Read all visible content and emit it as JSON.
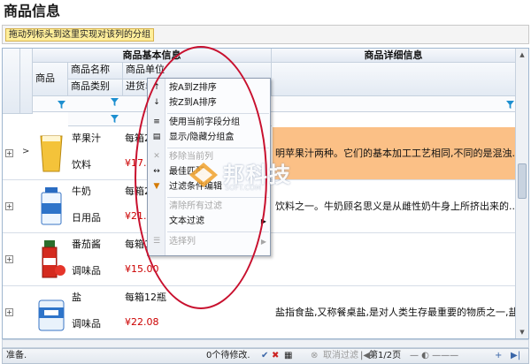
{
  "page": {
    "title": "商品信息"
  },
  "group_panel": {
    "hint": "拖动列标头到这里实现对该列的分组"
  },
  "grid": {
    "band_basic": "商品基本信息",
    "band_detail": "商品详细信息",
    "col_product": "商品",
    "col_name": "商品名称",
    "col_category": "商品类别",
    "col_unit": "商品单位",
    "col_price": "进货单价",
    "rows": [
      {
        "name": "苹果汁",
        "category": "饮料",
        "unit": "每箱24瓶",
        "price": "¥17.00",
        "detail": "明苹果汁两种。它们的基本加工工艺相同,不同的是混浊..."
      },
      {
        "name": "牛奶",
        "category": "日用品",
        "unit": "每箱24瓶",
        "price": "¥21.35",
        "detail": "饮料之一。牛奶顾名思义是从雌性奶牛身上所挤出来的..."
      },
      {
        "name": "番茄酱",
        "category": "调味品",
        "unit": "每箱12瓶",
        "price": "¥15.00",
        "detail": ""
      },
      {
        "name": "盐",
        "category": "调味品",
        "unit": "每箱12瓶",
        "price": "¥22.08",
        "detail": "盐指食盐,又称餐桌盐,是对人类生存最重要的物质之一,盐的主要化学成份氯..."
      }
    ]
  },
  "context_menu": {
    "items": [
      {
        "icon": "sort-ascending-icon",
        "glyph": "↑",
        "label": "按A到Z排序",
        "enabled": true
      },
      {
        "icon": "sort-descending-icon",
        "glyph": "↓",
        "label": "按Z到A排序",
        "enabled": true
      },
      {
        "icon": "group-by-icon",
        "glyph": "≡",
        "label": "使用当前字段分组",
        "enabled": true
      },
      {
        "icon": "group-panel-icon",
        "glyph": "▤",
        "label": "显示/隐藏分组盒",
        "enabled": true
      },
      {
        "icon": "remove-column-icon",
        "glyph": "✕",
        "label": "移除当前列",
        "enabled": false
      },
      {
        "icon": "best-fit-icon",
        "glyph": "↔",
        "label": "最佳匹配",
        "enabled": true
      },
      {
        "icon": "filter-editor-icon",
        "glyph": "▼",
        "label": "过滤条件编辑",
        "enabled": true
      },
      {
        "icon": "clear-filter-icon",
        "glyph": "",
        "label": "清除所有过滤",
        "enabled": false
      },
      {
        "icon": "",
        "glyph": "",
        "label": "文本过滤",
        "enabled": true,
        "submenu": true
      },
      {
        "icon": "choose-column-icon",
        "glyph": "☰",
        "label": "选择列",
        "enabled": false,
        "submenu": true
      }
    ]
  },
  "status_bar": {
    "ready": "准备.",
    "pending": "0个待修改.",
    "cancel_filter": "取消过滤",
    "page_info": "第1/2页"
  },
  "watermark": {
    "text": "邦科技",
    "sub": "SOFT.COM"
  },
  "colors": {
    "selected_row": "#fbc086",
    "price": "#cc0000",
    "annotation": "#c8102e"
  }
}
